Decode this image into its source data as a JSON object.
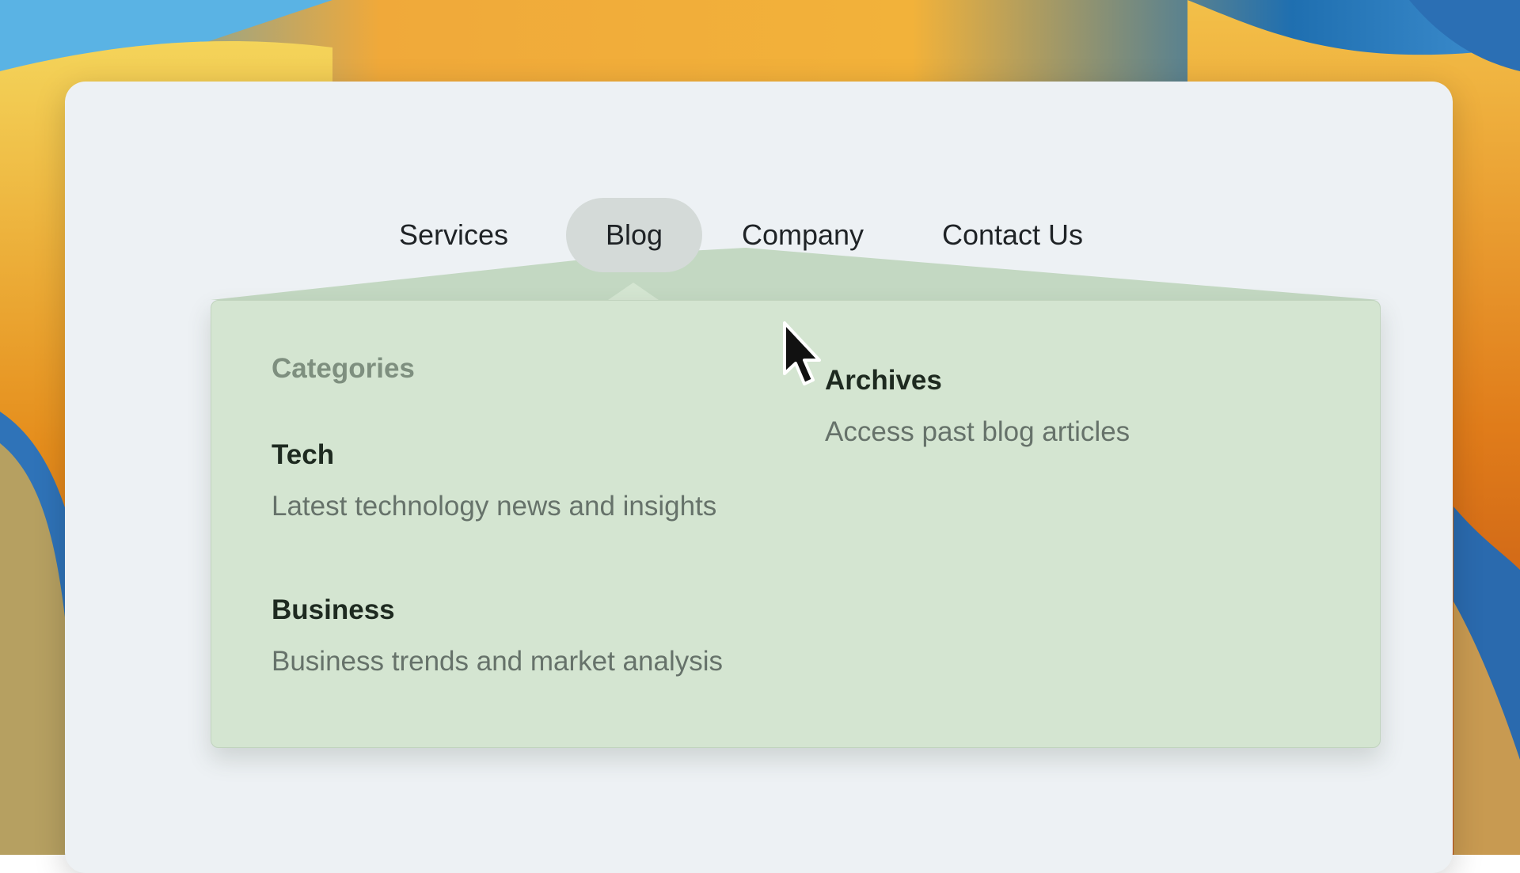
{
  "nav": {
    "items": [
      {
        "label": "Services"
      },
      {
        "label": "Blog"
      },
      {
        "label": "Company"
      },
      {
        "label": "Contact Us"
      }
    ],
    "active": "Blog"
  },
  "dropdown": {
    "section_label": "Categories",
    "items": [
      {
        "title": "Tech",
        "description": "Latest technology news and insights"
      },
      {
        "title": "Business",
        "description": "Business trends and market analysis"
      },
      {
        "title": "Archives",
        "description": "Access past blog articles"
      }
    ]
  },
  "colors": {
    "window_bg": "#edf1f4",
    "dropdown_bg": "#d4e5d1",
    "active_pill": "#d4dad8",
    "text_dark": "#1f2326",
    "text_muted": "#66726a",
    "section_label": "#7e8f7f"
  },
  "icons": {
    "cursor": "mouse-pointer-icon"
  }
}
